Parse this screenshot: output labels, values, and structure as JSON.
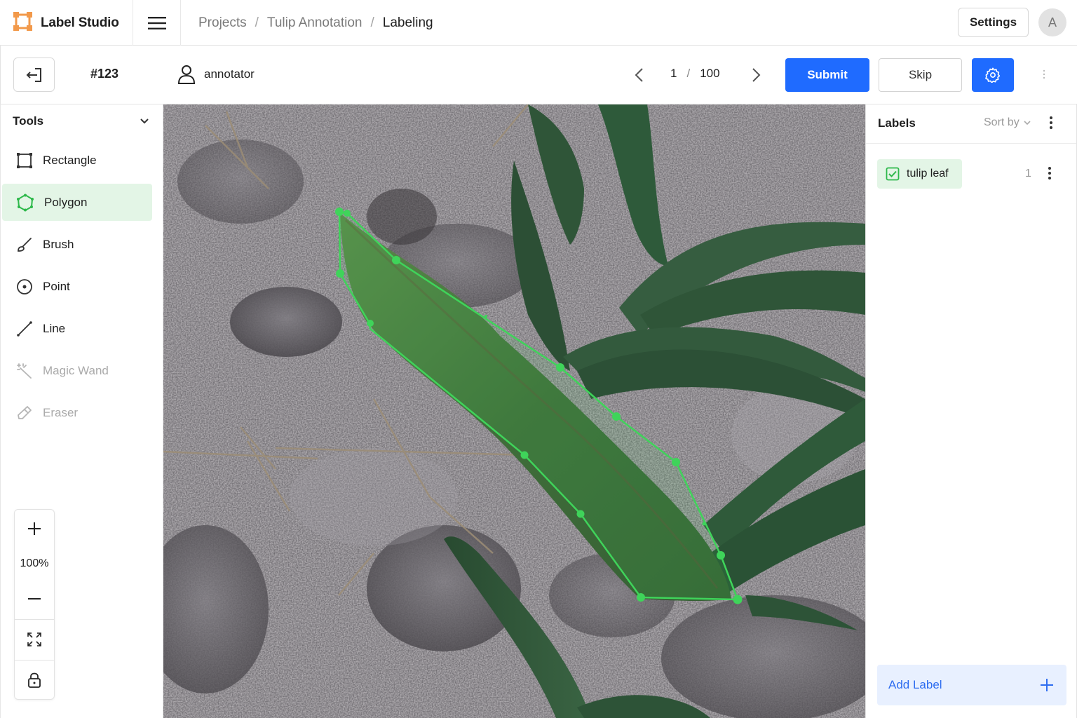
{
  "app": {
    "name": "Label Studio",
    "accent": "#1f6bff",
    "logo_color": "#f2994a"
  },
  "breadcrumb": {
    "items": [
      "Projects",
      "Tulip Annotation",
      "Labeling"
    ],
    "separator": "/"
  },
  "header": {
    "settings_label": "Settings",
    "avatar_initial": "A"
  },
  "toolbar": {
    "task_id": "#123",
    "user": "annotator",
    "page_current": "1",
    "page_separator": "/",
    "page_total": "100",
    "submit_label": "Submit",
    "skip_label": "Skip"
  },
  "tools": {
    "title": "Tools",
    "items": [
      {
        "label": "Rectangle",
        "icon": "rectangle-icon",
        "state": "normal"
      },
      {
        "label": "Polygon",
        "icon": "polygon-icon",
        "state": "active"
      },
      {
        "label": "Brush",
        "icon": "brush-icon",
        "state": "normal"
      },
      {
        "label": "Point",
        "icon": "point-icon",
        "state": "normal"
      },
      {
        "label": "Line",
        "icon": "line-icon",
        "state": "normal"
      },
      {
        "label": "Magic Wand",
        "icon": "magic-wand-icon",
        "state": "disabled"
      },
      {
        "label": "Eraser",
        "icon": "eraser-icon",
        "state": "disabled"
      }
    ],
    "zoom_level": "100%"
  },
  "annotation": {
    "color": "#3fd45a",
    "label": "tulip leaf"
  },
  "labels": {
    "title": "Labels",
    "sort_label": "Sort by",
    "items": [
      {
        "label": "tulip leaf",
        "count": "1"
      }
    ],
    "add_label": "Add Label"
  }
}
